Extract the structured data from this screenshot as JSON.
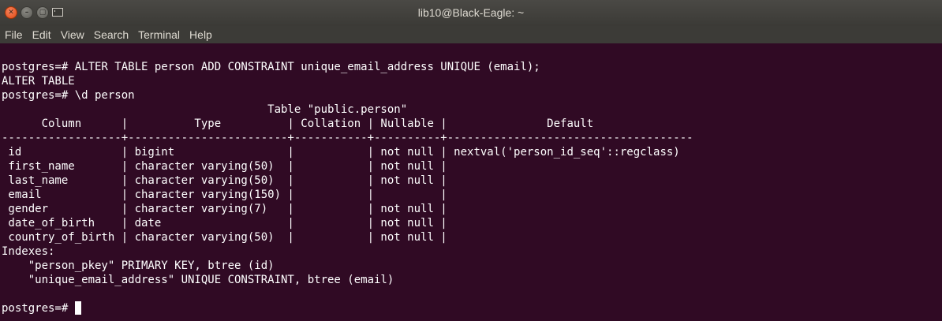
{
  "window": {
    "title": "lib10@Black-Eagle: ~",
    "controls": [
      "close-icon",
      "minimize-icon",
      "maximize-icon"
    ],
    "colors": {
      "titlebar": "#3c3b37",
      "terminal_bg": "#300a24",
      "close": "#e95420"
    }
  },
  "menu": [
    "File",
    "Edit",
    "View",
    "Search",
    "Terminal",
    "Help"
  ],
  "terminal": {
    "lines": [
      "postgres=# ALTER TABLE person ADD CONSTRAINT unique_email_address UNIQUE (email);",
      "ALTER TABLE",
      "postgres=# \\d person",
      "                                        Table \"public.person\"",
      "      Column      |          Type          | Collation | Nullable |               Default",
      "------------------+------------------------+-----------+----------+-------------------------------------",
      " id               | bigint                 |           | not null | nextval('person_id_seq'::regclass)",
      " first_name       | character varying(50)  |           | not null |",
      " last_name        | character varying(50)  |           | not null |",
      " email            | character varying(150) |           |          |",
      " gender           | character varying(7)   |           | not null |",
      " date_of_birth    | date                   |           | not null |",
      " country_of_birth | character varying(50)  |           | not null |",
      "Indexes:",
      "    \"person_pkey\" PRIMARY KEY, btree (id)",
      "    \"unique_email_address\" UNIQUE CONSTRAINT, btree (email)",
      ""
    ],
    "prompt": "postgres=# "
  }
}
